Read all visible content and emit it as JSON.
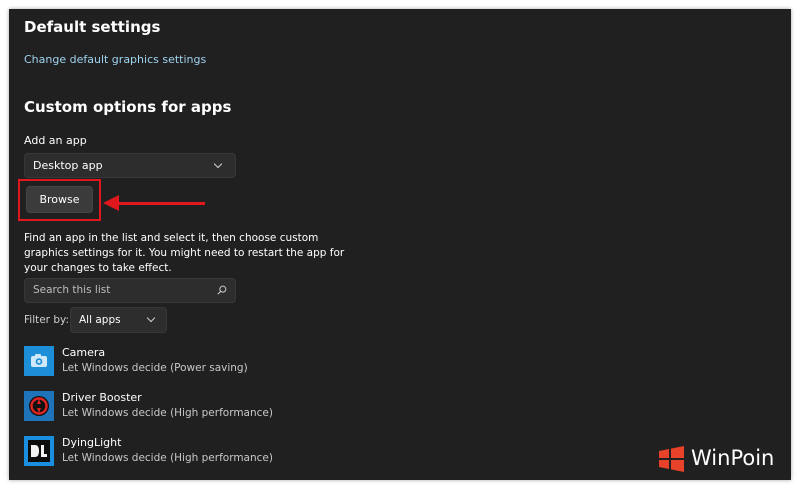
{
  "default_settings": {
    "heading": "Default settings",
    "link": "Change default graphics settings"
  },
  "custom": {
    "heading": "Custom options for apps",
    "add_label": "Add an app",
    "app_type": "Desktop app",
    "browse_label": "Browse",
    "description": "Find an app in the list and select it, then choose custom graphics settings for it. You might need to restart the app for your changes to take effect."
  },
  "search": {
    "placeholder": "Search this list"
  },
  "filter": {
    "label": "Filter by:",
    "value": "All apps"
  },
  "apps": [
    {
      "name": "Camera",
      "status": "Let Windows decide (Power saving)",
      "icon": "camera-icon"
    },
    {
      "name": "Driver Booster",
      "status": "Let Windows decide (High performance)",
      "icon": "driver-booster-icon"
    },
    {
      "name": "DyingLight",
      "status": "Let Windows decide (High performance)",
      "icon": "dying-light-icon"
    }
  ],
  "watermark": {
    "text": "WinPoin"
  },
  "colors": {
    "background": "#202020",
    "link": "#9fd3f0",
    "highlight": "#e0181e"
  }
}
